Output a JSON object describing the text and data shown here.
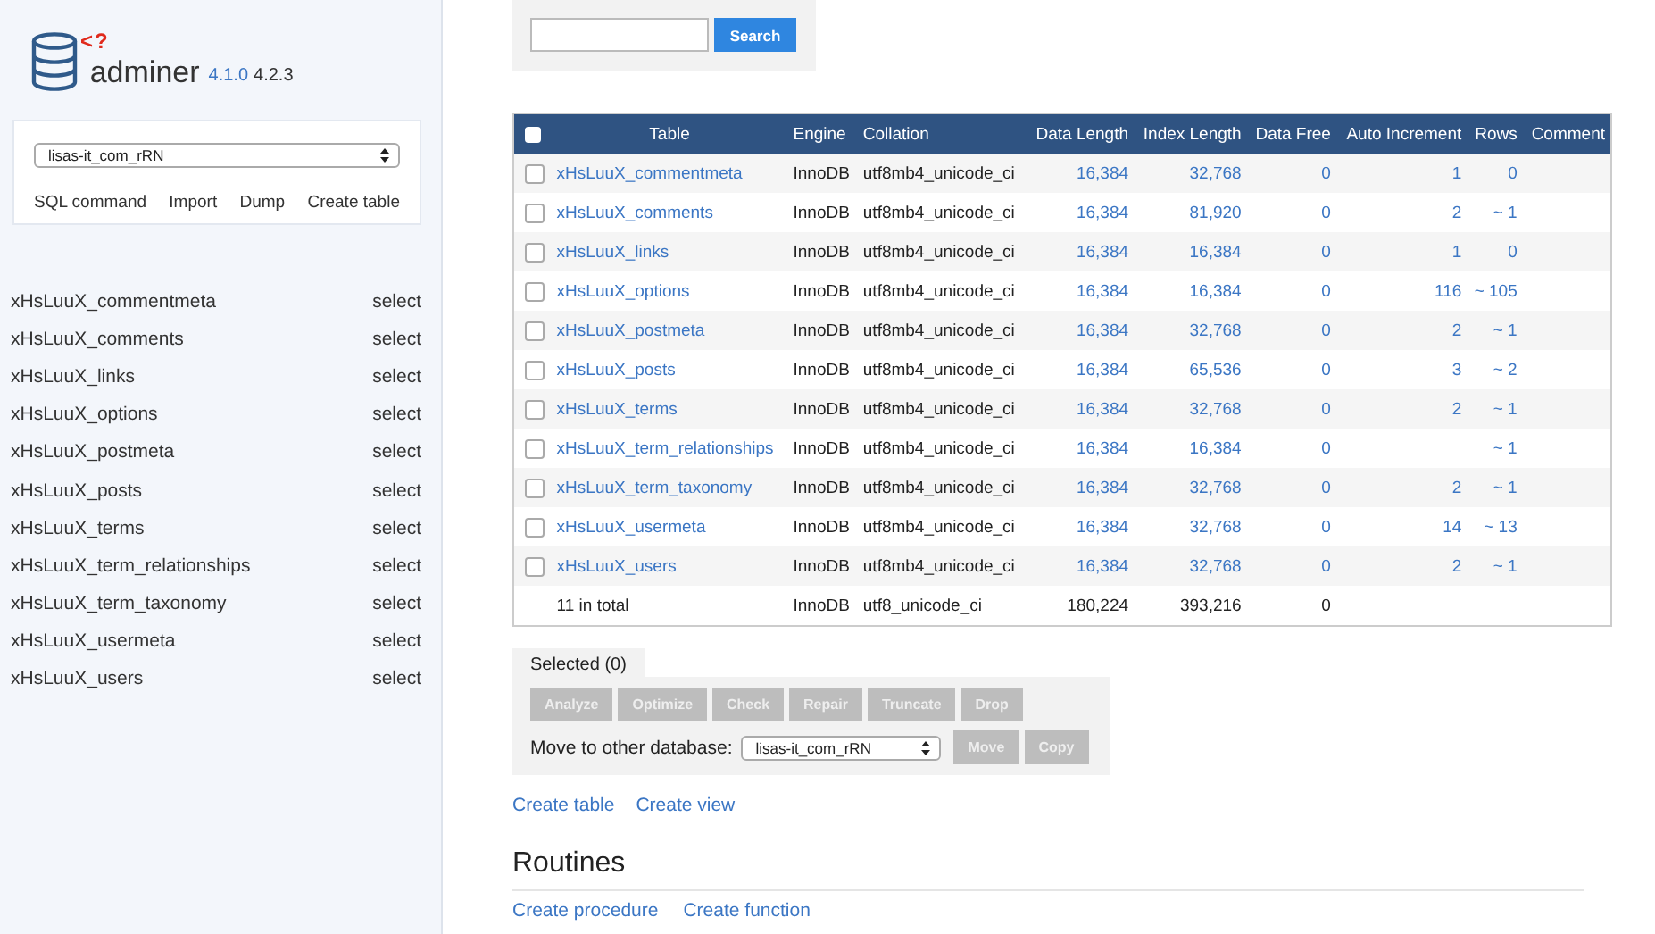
{
  "sidebar": {
    "logo": {
      "mark": "<?",
      "name": "adminer",
      "version_old": "4.1.0",
      "version_new": "4.2.3"
    },
    "database": "lisas-it_com_rRN",
    "links": [
      "SQL command",
      "Import",
      "Dump",
      "Create table"
    ],
    "tables": [
      {
        "name": "xHsLuuX_commentmeta",
        "action": "select"
      },
      {
        "name": "xHsLuuX_comments",
        "action": "select"
      },
      {
        "name": "xHsLuuX_links",
        "action": "select"
      },
      {
        "name": "xHsLuuX_options",
        "action": "select"
      },
      {
        "name": "xHsLuuX_postmeta",
        "action": "select"
      },
      {
        "name": "xHsLuuX_posts",
        "action": "select"
      },
      {
        "name": "xHsLuuX_terms",
        "action": "select"
      },
      {
        "name": "xHsLuuX_term_relationships",
        "action": "select"
      },
      {
        "name": "xHsLuuX_term_taxonomy",
        "action": "select"
      },
      {
        "name": "xHsLuuX_usermeta",
        "action": "select"
      },
      {
        "name": "xHsLuuX_users",
        "action": "select"
      }
    ]
  },
  "search": {
    "button": "Search"
  },
  "table": {
    "all_checked": false,
    "columns": [
      "Table",
      "Engine",
      "Collation",
      "Data Length",
      "Index Length",
      "Data Free",
      "Auto Increment",
      "Rows",
      "Comment"
    ],
    "rows": [
      {
        "checked": false,
        "table": "xHsLuuX_commentmeta",
        "engine": "InnoDB",
        "collation": "utf8mb4_unicode_ci",
        "data_length": "16,384",
        "index_length": "32,768",
        "data_free": "0",
        "auto_increment": "1",
        "rows": "0"
      },
      {
        "checked": false,
        "table": "xHsLuuX_comments",
        "engine": "InnoDB",
        "collation": "utf8mb4_unicode_ci",
        "data_length": "16,384",
        "index_length": "81,920",
        "data_free": "0",
        "auto_increment": "2",
        "rows": "~ 1"
      },
      {
        "checked": false,
        "table": "xHsLuuX_links",
        "engine": "InnoDB",
        "collation": "utf8mb4_unicode_ci",
        "data_length": "16,384",
        "index_length": "16,384",
        "data_free": "0",
        "auto_increment": "1",
        "rows": "0"
      },
      {
        "checked": false,
        "table": "xHsLuuX_options",
        "engine": "InnoDB",
        "collation": "utf8mb4_unicode_ci",
        "data_length": "16,384",
        "index_length": "16,384",
        "data_free": "0",
        "auto_increment": "116",
        "rows": "~ 105"
      },
      {
        "checked": false,
        "table": "xHsLuuX_postmeta",
        "engine": "InnoDB",
        "collation": "utf8mb4_unicode_ci",
        "data_length": "16,384",
        "index_length": "32,768",
        "data_free": "0",
        "auto_increment": "2",
        "rows": "~ 1"
      },
      {
        "checked": false,
        "table": "xHsLuuX_posts",
        "engine": "InnoDB",
        "collation": "utf8mb4_unicode_ci",
        "data_length": "16,384",
        "index_length": "65,536",
        "data_free": "0",
        "auto_increment": "3",
        "rows": "~ 2"
      },
      {
        "checked": false,
        "table": "xHsLuuX_terms",
        "engine": "InnoDB",
        "collation": "utf8mb4_unicode_ci",
        "data_length": "16,384",
        "index_length": "32,768",
        "data_free": "0",
        "auto_increment": "2",
        "rows": "~ 1"
      },
      {
        "checked": false,
        "table": "xHsLuuX_term_relationships",
        "engine": "InnoDB",
        "collation": "utf8mb4_unicode_ci",
        "data_length": "16,384",
        "index_length": "16,384",
        "data_free": "0",
        "rows": "~ 1"
      },
      {
        "checked": false,
        "table": "xHsLuuX_term_taxonomy",
        "engine": "InnoDB",
        "collation": "utf8mb4_unicode_ci",
        "data_length": "16,384",
        "index_length": "32,768",
        "data_free": "0",
        "auto_increment": "2",
        "rows": "~ 1"
      },
      {
        "checked": false,
        "table": "xHsLuuX_usermeta",
        "engine": "InnoDB",
        "collation": "utf8mb4_unicode_ci",
        "data_length": "16,384",
        "index_length": "32,768",
        "data_free": "0",
        "auto_increment": "14",
        "rows": "~ 13"
      },
      {
        "checked": false,
        "table": "xHsLuuX_users",
        "engine": "InnoDB",
        "collation": "utf8mb4_unicode_ci",
        "data_length": "16,384",
        "index_length": "32,768",
        "data_free": "0",
        "auto_increment": "2",
        "rows": "~ 1"
      }
    ],
    "total": {
      "table": "11 in total",
      "engine": "InnoDB",
      "collation": "utf8_unicode_ci",
      "data_length": "180,224",
      "index_length": "393,216",
      "data_free": "0"
    }
  },
  "selected": {
    "legend": "Selected (0)",
    "buttons": [
      {
        "label": "Analyze",
        "disabled": true
      },
      {
        "label": "Optimize",
        "disabled": true
      },
      {
        "label": "Check",
        "disabled": true
      },
      {
        "label": "Repair",
        "disabled": true
      },
      {
        "label": "Truncate",
        "disabled": true
      },
      {
        "label": "Drop",
        "disabled": true
      }
    ],
    "move_label": "Move to other database:",
    "database": "lisas-it_com_rRN",
    "move_buttons": [
      {
        "label": "Move",
        "disabled": true
      },
      {
        "label": "Copy",
        "disabled": true
      }
    ]
  },
  "links": [
    "Create table",
    "Create view"
  ],
  "routines": {
    "title": "Routines",
    "links": [
      "Create procedure",
      "Create function"
    ]
  }
}
